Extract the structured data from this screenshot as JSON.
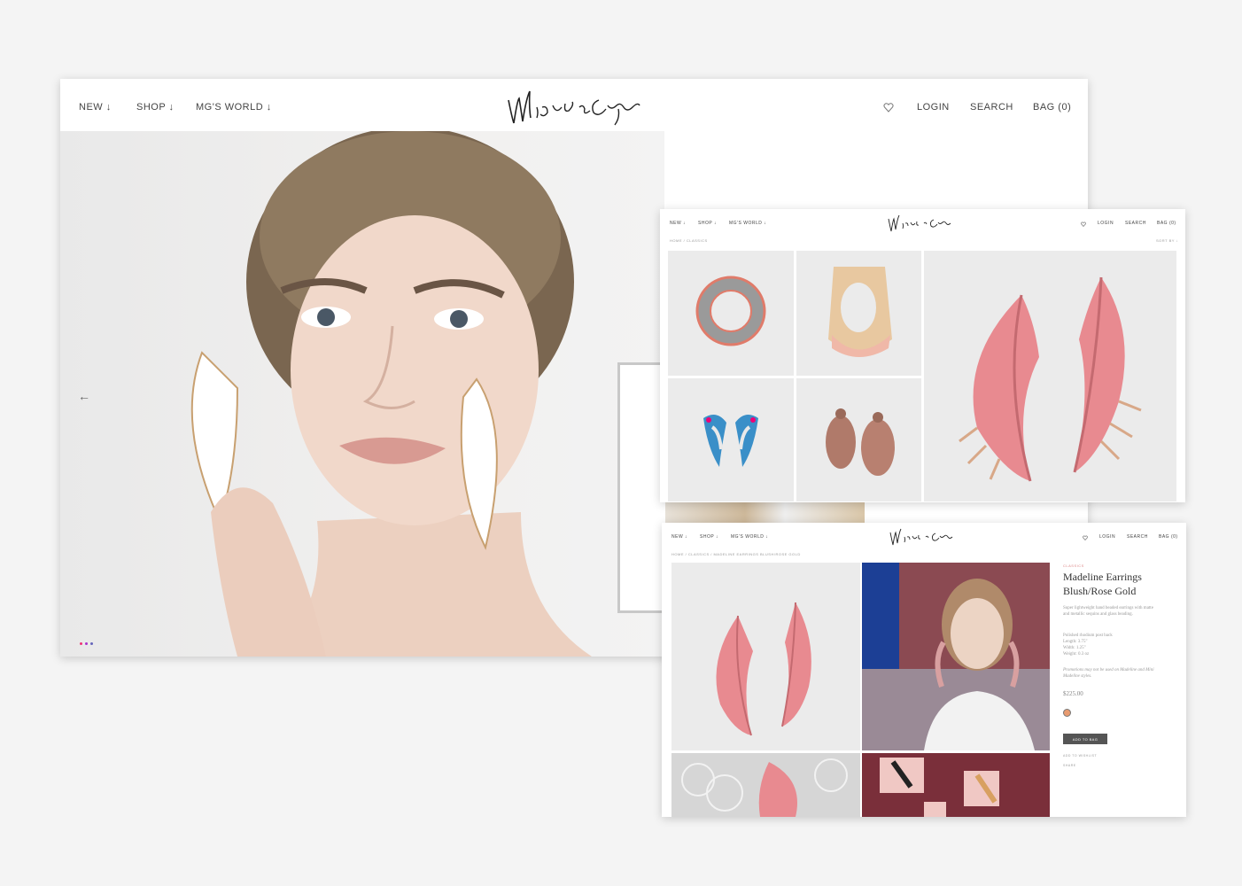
{
  "main": {
    "nav": {
      "new": "NEW ↓",
      "shop": "SHOP ↓",
      "world": "MG'S WORLD ↓"
    },
    "right": {
      "login": "LOGIN",
      "search": "SEARCH",
      "bag": "BAG (0)"
    },
    "prev_arrow": "←"
  },
  "listing": {
    "nav": {
      "new": "NEW ↓",
      "shop": "SHOP ↓",
      "world": "MG'S WORLD ↓"
    },
    "right": {
      "login": "LOGIN",
      "search": "SEARCH",
      "bag": "BAG (0)"
    },
    "breadcrumb": "HOME / CLASSICS",
    "sort": "SORT BY ↓"
  },
  "product": {
    "nav": {
      "new": "NEW ↓",
      "shop": "SHOP ↓",
      "world": "MG'S WORLD ↓"
    },
    "right": {
      "login": "LOGIN",
      "search": "SEARCH",
      "bag": "BAG (0)"
    },
    "breadcrumb": "HOME / CLASSICS / MADELINE EARRINGS BLUSH/ROSE GOLD",
    "category": "CLASSICS",
    "title_line1": "Madeline Earrings",
    "title_line2": "Blush/Rose Gold",
    "description": "Super lightweight hand beaded earrings with matte and metallic sequins and glass beading.",
    "details": [
      "Polished rhodium post back",
      "Length: 3.75\"",
      "Width: 1.25\"",
      "Weight: 0.3 oz"
    ],
    "note": "Promotions may not be used on Madeline and Mini Madeline styles.",
    "price": "$225.00",
    "add_to_bag": "ADD TO BAG",
    "wishlist": "ADD TO WISHLIST",
    "share": "SHARE"
  },
  "colors": {
    "accent": "#e8848a",
    "swatch": "#e89b70",
    "blue": "#1c3f95",
    "maroon": "#8b4a52"
  }
}
